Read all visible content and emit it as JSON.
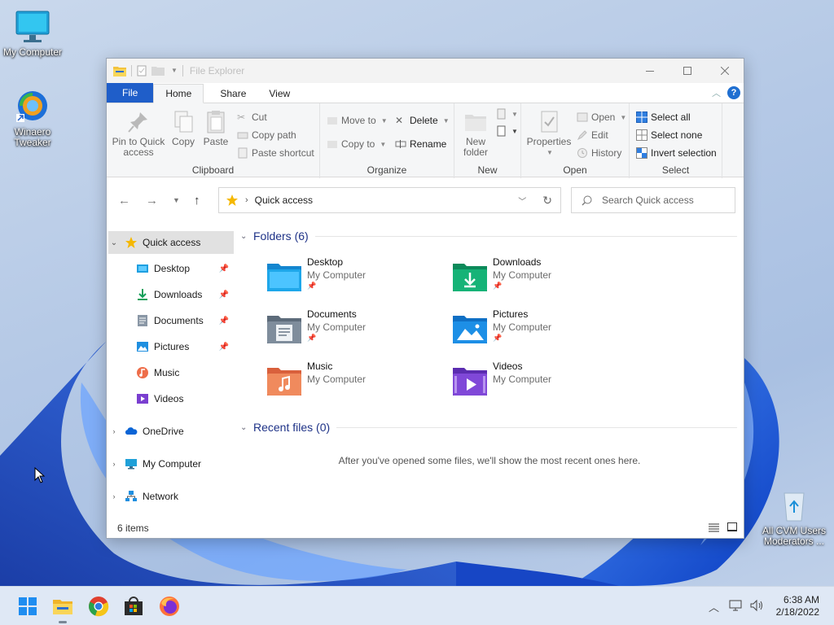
{
  "desktop": {
    "icons": [
      {
        "label": "My Computer"
      },
      {
        "label": "Winaero Tweaker"
      },
      {
        "label": "All CVM Users Moderators ..."
      }
    ]
  },
  "window": {
    "title": "File Explorer",
    "tabs": [
      "File",
      "Home",
      "Share",
      "View"
    ],
    "ribbon": {
      "clipboard": {
        "label": "Clipboard",
        "pin": "Pin to Quick access",
        "copy": "Copy",
        "paste": "Paste",
        "cut": "Cut",
        "copy_path": "Copy path",
        "paste_shortcut": "Paste shortcut"
      },
      "organize": {
        "label": "Organize",
        "move_to": "Move to",
        "copy_to": "Copy to",
        "delete": "Delete",
        "rename": "Rename"
      },
      "new": {
        "label": "New",
        "new_folder": "New folder"
      },
      "open": {
        "label": "Open",
        "properties": "Properties",
        "open": "Open",
        "edit": "Edit",
        "history": "History"
      },
      "select": {
        "label": "Select",
        "select_all": "Select all",
        "select_none": "Select none",
        "invert": "Invert selection"
      }
    },
    "address": {
      "path": "Quick access",
      "search_placeholder": "Search Quick access"
    },
    "navpane": {
      "quick_access": "Quick access",
      "items": [
        "Desktop",
        "Downloads",
        "Documents",
        "Pictures",
        "Music",
        "Videos"
      ],
      "onedrive": "OneDrive",
      "my_computer": "My Computer",
      "network": "Network"
    },
    "folders_header": "Folders (6)",
    "folders": [
      {
        "name": "Desktop",
        "location": "My Computer"
      },
      {
        "name": "Downloads",
        "location": "My Computer"
      },
      {
        "name": "Documents",
        "location": "My Computer"
      },
      {
        "name": "Pictures",
        "location": "My Computer"
      },
      {
        "name": "Music",
        "location": "My Computer"
      },
      {
        "name": "Videos",
        "location": "My Computer"
      }
    ],
    "recent_header": "Recent files (0)",
    "recent_empty": "After you've opened some files, we'll show the most recent ones here.",
    "status": "6 items"
  },
  "taskbar": {
    "time": "6:38 AM",
    "date": "2/18/2022",
    "apps": [
      "start-icon",
      "file-explorer-icon",
      "chrome-icon",
      "store-icon",
      "firefox-icon"
    ]
  },
  "colors": {
    "accent": "#1f5ec9",
    "selection": "#e1e1e1",
    "section_header": "#1e3287"
  }
}
